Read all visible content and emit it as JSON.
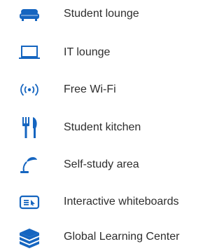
{
  "accent_color": "#1565c0",
  "amenities": [
    {
      "icon": "sofa-icon",
      "label": "Student lounge"
    },
    {
      "icon": "laptop-icon",
      "label": "IT lounge"
    },
    {
      "icon": "wifi-icon",
      "label": "Free Wi-Fi"
    },
    {
      "icon": "fork-knife-icon",
      "label": "Student kitchen"
    },
    {
      "icon": "desk-lamp-icon",
      "label": "Self-study area"
    },
    {
      "icon": "whiteboard-icon",
      "label": "Interactive whiteboards"
    },
    {
      "icon": "books-icon",
      "label": "Global Learning Center"
    }
  ]
}
